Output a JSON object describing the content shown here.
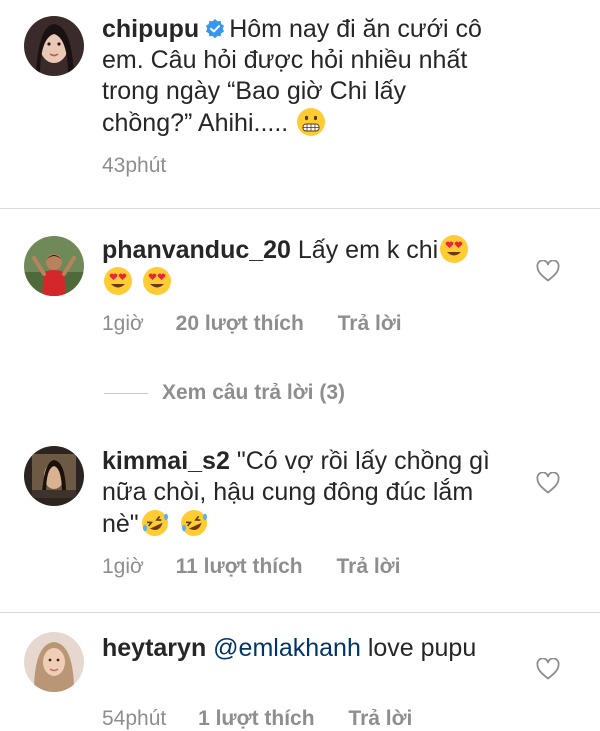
{
  "caption": {
    "username": "chipupu",
    "text": "Hôm nay đi ăn cưới cô em. Câu hỏi được hỏi nhiều nhất trong ngày “Bao giờ Chi lấy chồng?” Ahihi.....",
    "emoji": "grimacing-face-emoji",
    "time": "43phút"
  },
  "view_replies_label": "Xem câu trả lời (3)",
  "comments": [
    {
      "username": "phanvanduc_20",
      "text": "Lấy em k chi",
      "emojis": [
        "heart-eyes-emoji",
        "heart-eyes-emoji",
        "heart-eyes-emoji"
      ],
      "time": "1giờ",
      "likes": "20 lượt thích",
      "reply": "Trả lời"
    },
    {
      "username": "kimmai_s2",
      "text": "\"Có vợ rồi lấy chồng gì nữa chòi, hậu cung đông đúc lắm nè\"",
      "emojis": [
        "rofl-emoji",
        "rofl-emoji"
      ],
      "time": "1giờ",
      "likes": "11 lượt thích",
      "reply": "Trả lời"
    },
    {
      "username": "heytaryn",
      "mention": "@emlakhanh",
      "text": "love pupu",
      "time": "54phút",
      "likes": "1 lượt thích",
      "reply": "Trả lời"
    }
  ],
  "colors": {
    "text": "#262626",
    "meta": "#8e8e8e",
    "mention": "#003569",
    "verified": "#3897f0",
    "divider": "#dbdbdb"
  }
}
